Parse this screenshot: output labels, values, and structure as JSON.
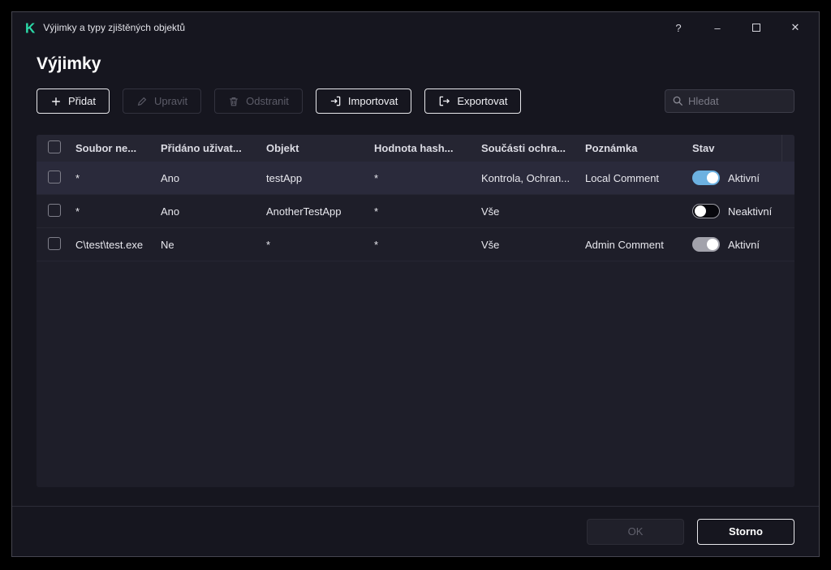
{
  "window": {
    "title": "Výjimky a typy zjištěných objektů",
    "controls": {
      "help": "?",
      "minimize": "–",
      "close": "✕"
    }
  },
  "page": {
    "title": "Výjimky"
  },
  "toolbar": {
    "add": "Přidat",
    "edit": "Upravit",
    "delete": "Odstranit",
    "import": "Importovat",
    "export": "Exportovat",
    "search_placeholder": "Hledat"
  },
  "table": {
    "columns": [
      "Soubor ne...",
      "Přidáno uživat...",
      "Objekt",
      "Hodnota hash...",
      "Součásti ochra...",
      "Poznámka",
      "Stav"
    ],
    "rows": [
      {
        "file": "*",
        "added_by_user": "Ano",
        "object": "testApp",
        "hash": "*",
        "components": "Kontrola, Ochran...",
        "comment": "Local Comment",
        "status": "Aktivní",
        "toggle": "on-blue",
        "selected": true
      },
      {
        "file": "*",
        "added_by_user": "Ano",
        "object": "AnotherTestApp",
        "hash": "*",
        "components": "Vše",
        "comment": "",
        "status": "Neaktivní",
        "toggle": "off",
        "selected": false
      },
      {
        "file": "C\\test\\test.exe",
        "added_by_user": "Ne",
        "object": "*",
        "hash": "*",
        "components": "Vše",
        "comment": "Admin Comment",
        "status": "Aktivní",
        "toggle": "on-gray",
        "selected": false
      }
    ]
  },
  "footer": {
    "ok": "OK",
    "cancel": "Storno"
  },
  "colors": {
    "accent_green": "#2bd9a7",
    "toggle_blue": "#6cb1e1"
  }
}
